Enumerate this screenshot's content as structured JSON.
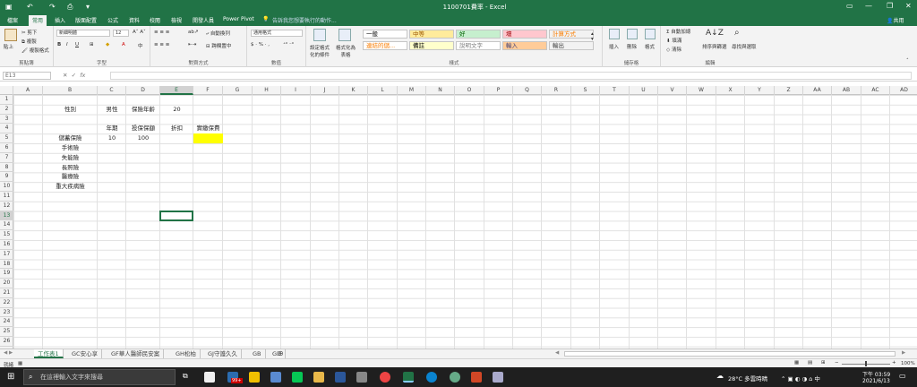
{
  "title": "1100701費率 - Excel",
  "quick_search_placeholder": "告訴我您想要執行的動作...",
  "account": "",
  "tabs": [
    "檔案",
    "常用",
    "插入",
    "版面配置",
    "公式",
    "資料",
    "校閱",
    "檢視",
    "開發人員",
    "Power Pivot"
  ],
  "share_label": "共用",
  "ribbon": {
    "clipboard": {
      "label": "剪貼簿",
      "paste": "貼上",
      "cut": "剪下",
      "copy": "複製",
      "format_painter": "複製格式"
    },
    "font": {
      "label": "字型",
      "name": "新細明體",
      "size": "12"
    },
    "alignment": {
      "label": "對齊方式",
      "wrap": "自動換列",
      "merge": "跨欄置中"
    },
    "number": {
      "label": "數值",
      "format": "通用格式"
    },
    "conditional": "設定格式化的條件",
    "format_table": "格式化為表格",
    "styles_label": "樣式",
    "styles": [
      {
        "text": "一般",
        "bg": "#ffffff",
        "fg": "#000000"
      },
      {
        "text": "中等",
        "bg": "#ffeb9c",
        "fg": "#9c5700"
      },
      {
        "text": "好",
        "bg": "#c6efce",
        "fg": "#006100"
      },
      {
        "text": "壞",
        "bg": "#ffc7ce",
        "fg": "#9c0006"
      },
      {
        "text": "計算方式",
        "bg": "#f2f2f2",
        "fg": "#fa7d00"
      },
      {
        "text": "連結的儲...",
        "bg": "#ffffff",
        "fg": "#fa7d00"
      },
      {
        "text": "備註",
        "bg": "#ffffcc",
        "fg": "#000000"
      },
      {
        "text": "說明文字",
        "bg": "#ffffff",
        "fg": "#7f7f7f"
      },
      {
        "text": "輸入",
        "bg": "#ffcc99",
        "fg": "#3f3f76"
      },
      {
        "text": "輸出",
        "bg": "#f2f2f2",
        "fg": "#3f3f3f"
      }
    ],
    "cells": {
      "label": "儲存格",
      "insert": "插入",
      "delete": "刪除",
      "format": "格式"
    },
    "editing": {
      "label": "編輯",
      "autosum": "自動加總",
      "fill": "填滿",
      "clear": "清除",
      "sort": "排序與篩選",
      "find": "尋找與選取"
    }
  },
  "name_box": "E13",
  "formula": "",
  "columns": [
    "A",
    "B",
    "C",
    "D",
    "E",
    "F",
    "G",
    "H",
    "I",
    "J",
    "K",
    "L",
    "M",
    "N",
    "O",
    "P",
    "Q",
    "R",
    "S",
    "T",
    "U",
    "V",
    "W",
    "X",
    "Y",
    "Z",
    "AA",
    "AB",
    "AC",
    "AD"
  ],
  "rows": [
    "1",
    "2",
    "3",
    "4",
    "5",
    "6",
    "7",
    "8",
    "9",
    "10",
    "11",
    "12",
    "13",
    "14",
    "15",
    "16",
    "17",
    "18",
    "19",
    "20",
    "21",
    "22",
    "23",
    "24",
    "25",
    "26"
  ],
  "cells": {
    "B2": "性別",
    "C2": "男性",
    "D2": "保險年齡",
    "E2": "20",
    "C4": "年期",
    "D4": "投保保額",
    "E4": "折扣",
    "F4": "實繳保費",
    "B5": "儲蓄保險",
    "C5": "10",
    "D5": "100",
    "B6": "手術險",
    "B7": "失能險",
    "B8": "長照險",
    "B9": "醫療險",
    "B10": "重大疾病險"
  },
  "highlight_color": "#ffff00",
  "sheets": [
    "工作表1",
    "GC安心享",
    "GF華人醫師民安案",
    "GH松柏",
    "GJ守護久久",
    "GB",
    "GD"
  ],
  "status": {
    "ready": "就緒",
    "zoom": "100%"
  },
  "taskbar": {
    "search_placeholder": "在這裡輸入文字來搜尋",
    "weather": "28°C 多雲時晴",
    "time": "下午 03:59",
    "date": "2021/6/13",
    "badge": "99+"
  }
}
